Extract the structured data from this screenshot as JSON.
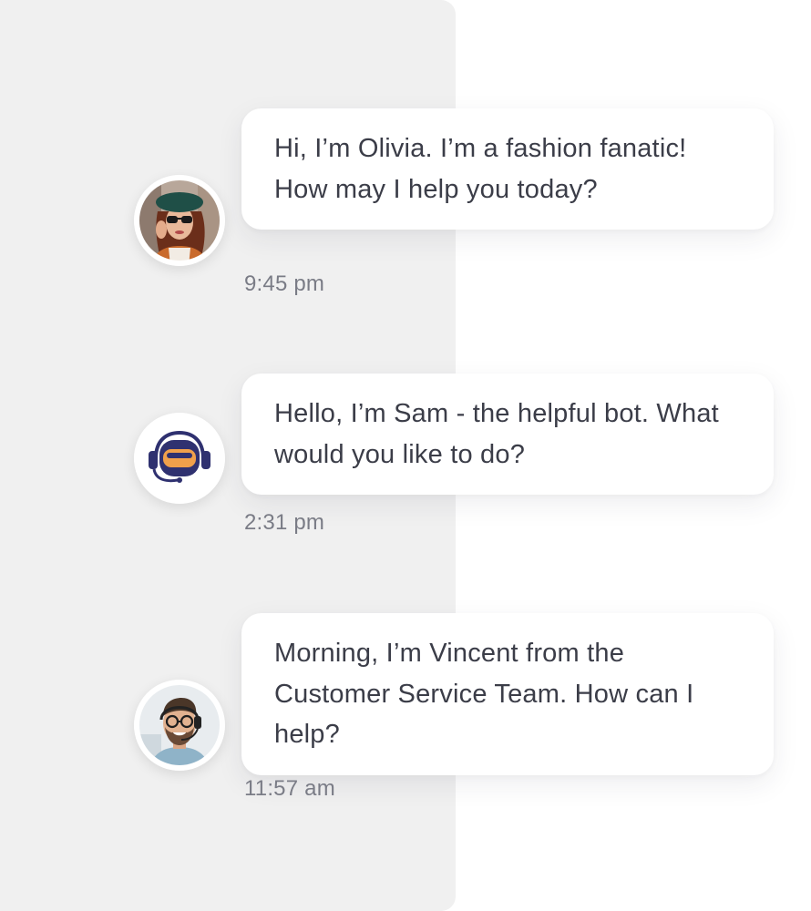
{
  "colors": {
    "panel_background": "#f0f0f0",
    "bubble_background": "#ffffff",
    "message_text": "#3b3d48",
    "timestamp_text": "#7a7c86",
    "bot_avatar_accent": "#f0a04b",
    "bot_avatar_dark": "#2f3170"
  },
  "messages": [
    {
      "sender_avatar_icon": "woman-avatar-icon",
      "text": "Hi, I’m Olivia. I’m a fashion fanatic! How may I help you today?",
      "time": "9:45 pm"
    },
    {
      "sender_avatar_icon": "robot-headset-icon",
      "text": "Hello, I’m Sam - the helpful bot. What would you like to do?",
      "time": "2:31 pm"
    },
    {
      "sender_avatar_icon": "man-headset-avatar-icon",
      "text": "Morning, I’m Vincent from the Customer Service Team. How can I help?",
      "time": "11:57 am"
    }
  ]
}
